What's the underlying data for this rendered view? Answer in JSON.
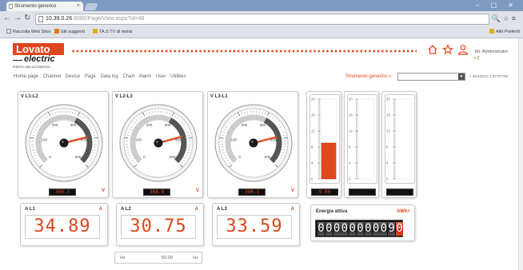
{
  "browser": {
    "tab_title": "Strumento generico",
    "url_host": "10.39.0.26",
    "url_rest": ":8080/Page/View.aspx?id=48",
    "bookmarks": [
      "Raccolta Web Slice",
      "Siti suggeriti",
      "TA.S TV di moira"
    ],
    "other_bookmarks": "Altri Preferiti"
  },
  "header": {
    "logo_text": "Lovato",
    "logo_sub": "electric",
    "logo_tag": "ENERGY AND AUTOMATION",
    "user_name": "Mr. Administrator",
    "user_count": "2"
  },
  "menu": [
    "Home page",
    "Channel",
    "Device",
    "Page",
    "Data log",
    "Chart",
    "Alarm",
    "User",
    "Utilities"
  ],
  "document": {
    "label": "Strumento generico",
    "selected": "",
    "datetime": "3/12/2013 3:37:07 PM"
  },
  "gauges": [
    {
      "title": "V L1-L2",
      "value": "390.3",
      "unit": "V",
      "max": 500,
      "reading": 390.3
    },
    {
      "title": "V L2-L3",
      "value": "388.9",
      "unit": "V",
      "max": 500,
      "reading": 388.9
    },
    {
      "title": "V L3-L1",
      "value": "390.1",
      "unit": "V",
      "max": 500,
      "reading": 390.1
    }
  ],
  "gauge_ticks": [
    "0",
    "100",
    "200",
    "300",
    "400",
    "500"
  ],
  "bars": [
    {
      "value": "9.00",
      "level": 9,
      "max": 20,
      "ticks": [
        "20",
        "16",
        "12",
        "8",
        "4",
        "0"
      ]
    },
    {
      "value": "-",
      "level": 0,
      "max": 20,
      "ticks": [
        "20",
        "16",
        "12",
        "8",
        "4",
        "0"
      ]
    },
    {
      "value": "-",
      "level": 0,
      "max": 20,
      "ticks": [
        "20",
        "16",
        "12",
        "8",
        "4",
        "0"
      ]
    }
  ],
  "currents": [
    {
      "label": "A L1",
      "unit": "A",
      "value": "34.89"
    },
    {
      "label": "A L2",
      "unit": "A",
      "value": "30.75"
    },
    {
      "label": "A L3",
      "unit": "A",
      "value": "33.59"
    }
  ],
  "frequency": {
    "label": "Hz",
    "value": "50.00",
    "unit": "Hz"
  },
  "energy": {
    "title": "Energia attiva",
    "unit": "kWh+",
    "digits": [
      "0",
      "0",
      "0",
      "0",
      "0",
      "0",
      "0",
      "0",
      "0",
      "9",
      "0"
    ]
  },
  "colors": {
    "accent": "#e0461c",
    "display_bg": "#111111"
  }
}
